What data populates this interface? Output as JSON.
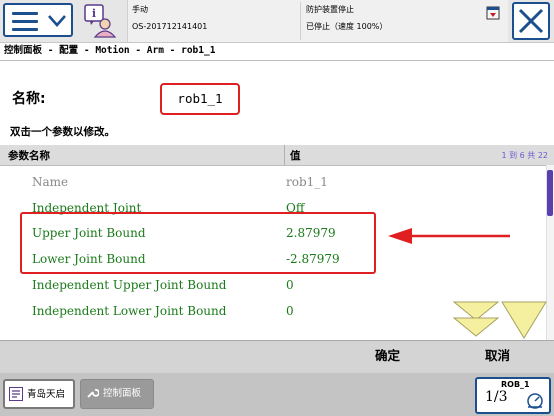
{
  "topbar": {
    "mode": "手动",
    "controller_id": "OS-201712141401",
    "safety_state": "防护装置停止",
    "run_state": "已停止（速度 100%）"
  },
  "breadcrumb": "控制面板 - 配置 - Motion - Arm - rob1_1",
  "name": {
    "label": "名称:",
    "value": "rob1_1"
  },
  "instruction": "双击一个参数以修改。",
  "table": {
    "header_param": "参数名称",
    "header_value": "值",
    "range_info": "1 到 6 共 22",
    "rows": [
      {
        "name": "Name",
        "value": "rob1_1",
        "color": "#888888"
      },
      {
        "name": "Independent Joint",
        "value": "Off",
        "color": "#1a7a1a"
      },
      {
        "name": "Upper Joint Bound",
        "value": "2.87979",
        "color": "#1a7a1a"
      },
      {
        "name": "Lower Joint Bound",
        "value": "-2.87979",
        "color": "#1a7a1a"
      },
      {
        "name": "Independent Upper Joint Bound",
        "value": "0",
        "color": "#1a7a1a"
      },
      {
        "name": "Independent Lower Joint Bound",
        "value": "0",
        "color": "#1a7a1a"
      }
    ]
  },
  "buttons": {
    "ok": "确定",
    "cancel": "取消"
  },
  "taskbar": {
    "items": [
      {
        "label": "青岛天启",
        "active": true
      },
      {
        "label": "控制面板",
        "active": false
      }
    ]
  },
  "quickset": {
    "robot": "ROB_1",
    "fraction": "1/3"
  },
  "colors": {
    "accent_blue": "#1c4f8e",
    "highlight_red": "#e02020",
    "param_green": "#1a7a1a",
    "scroll_purple": "#5a3fb0",
    "arrow_yellow": "#f4f0a0"
  },
  "icons": {
    "menu": "hamburger-menu-icon",
    "status": "robot-info-icon",
    "close": "close-icon",
    "scroll_down": "double-chevron-down-icon",
    "scroll_page": "triangle-down-icon"
  }
}
